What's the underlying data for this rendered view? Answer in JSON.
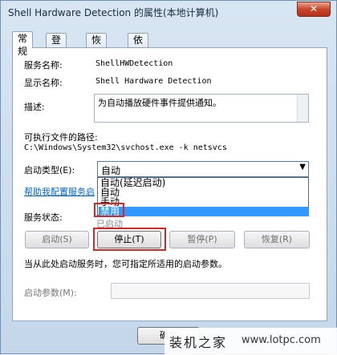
{
  "window": {
    "title": "Shell Hardware Detection 的属性(本地计算机)",
    "close_label": "✕"
  },
  "tabs": [
    "常规",
    "登录",
    "恢复",
    "依存关系"
  ],
  "general": {
    "service_name_label": "服务名称:",
    "service_name": "ShellHWDetection",
    "display_name_label": "显示名称:",
    "display_name": "Shell Hardware Detection",
    "description_label": "描述:",
    "description": "为自动播放硬件事件提供通知。",
    "exe_path_label": "可执行文件的路径:",
    "exe_path": "C:\\Windows\\System32\\svchost.exe -k netsvcs",
    "startup_type_label": "启动类型(E):",
    "startup_type_value": "自动",
    "startup_options": [
      "自动(延迟启动)",
      "自动",
      "手动",
      "禁用"
    ],
    "startup_selected_index": 3,
    "help_link": "帮助我配置服务启",
    "service_status_label": "服务状态:",
    "service_status_value": "已启动",
    "buttons": {
      "start": "启动(S)",
      "stop": "停止(T)",
      "pause": "暂停(P)",
      "resume": "恢复(R)"
    },
    "hint": "当从此处启动服务时，您可指定所适用的启动参数。",
    "start_params_label": "启动参数(M):",
    "start_params_value": ""
  },
  "footer": {
    "ok_label": "确定"
  },
  "watermark": {
    "logo_text": "装机之家",
    "url": "www.lotpc.com"
  }
}
